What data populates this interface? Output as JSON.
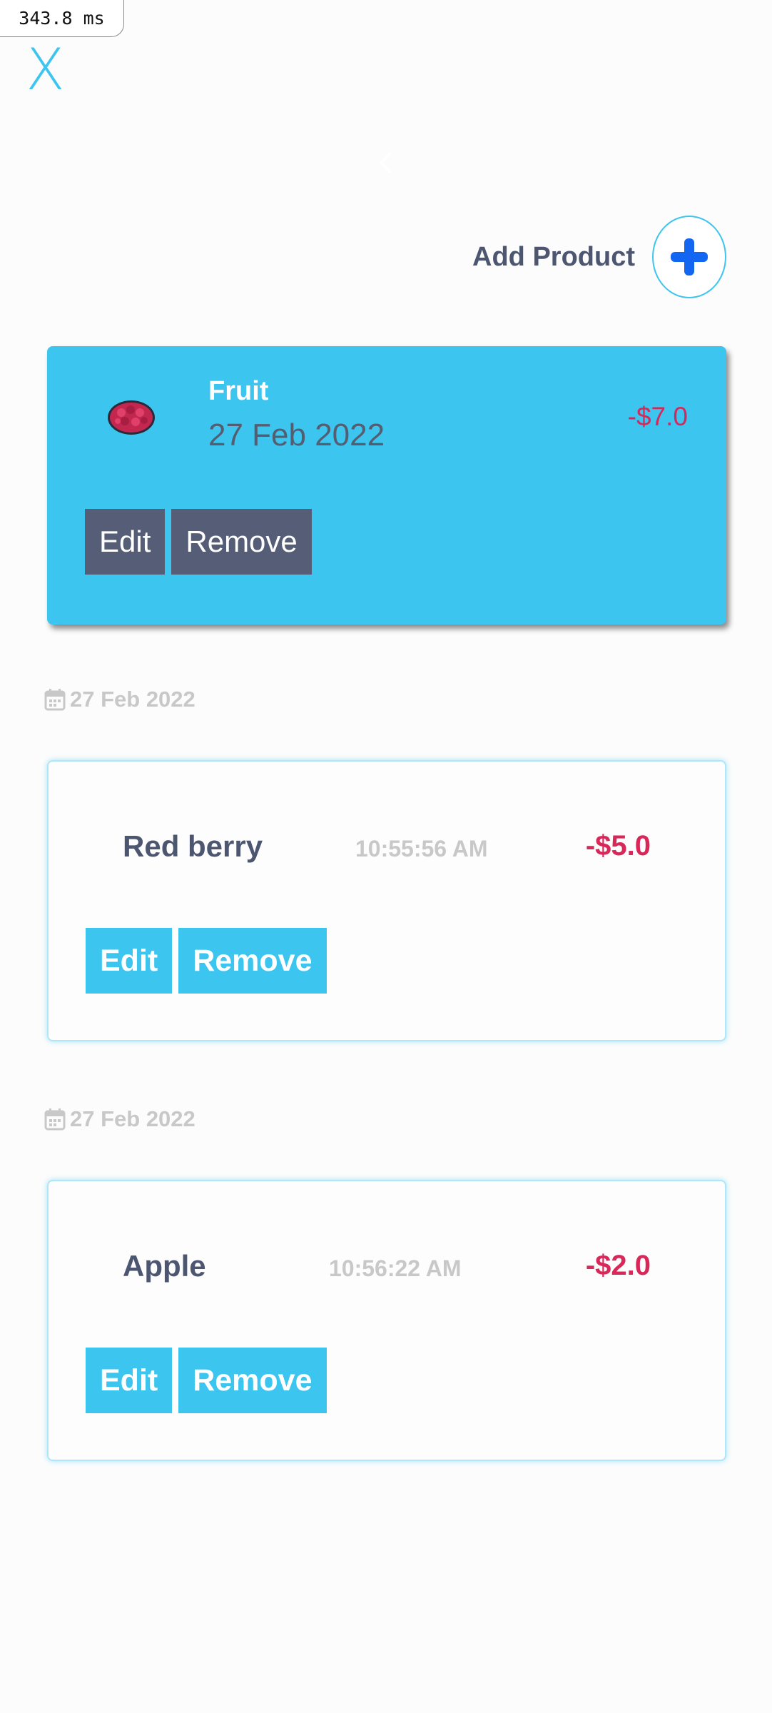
{
  "perf": {
    "text": "343.8 ms"
  },
  "header": {
    "close_label": "X",
    "add_product_label": "Add Product"
  },
  "category": {
    "name": "Fruit",
    "date": "27 Feb 2022",
    "amount": "-$7.0",
    "edit_label": "Edit",
    "remove_label": "Remove"
  },
  "items": [
    {
      "date": "27 Feb 2022",
      "name": "Red berry",
      "time": "10:55:56 AM",
      "amount": "-$5.0",
      "edit_label": "Edit",
      "remove_label": "Remove"
    },
    {
      "date": "27 Feb 2022",
      "name": "Apple",
      "time": "10:56:22 AM",
      "amount": "-$2.0",
      "edit_label": "Edit",
      "remove_label": "Remove"
    }
  ],
  "colors": {
    "accent": "#3bc5ef",
    "negative": "#d8285a",
    "dark_button": "#555d77",
    "text_dark": "#4d5670",
    "muted": "#c8c8c8",
    "plus_icon": "#1266f1"
  },
  "icons": {
    "close": "close-icon",
    "back": "chevron-left-icon",
    "add": "plus-icon",
    "calendar": "calendar-icon",
    "category_image": "raspberry-image"
  }
}
